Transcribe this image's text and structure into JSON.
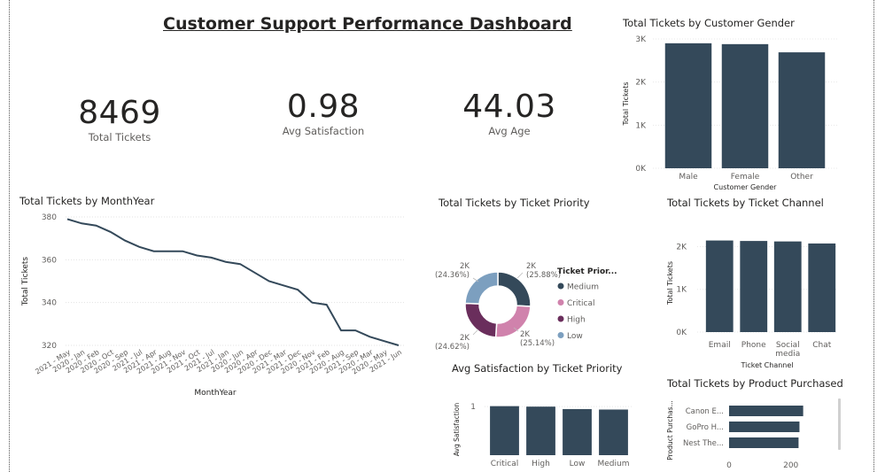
{
  "dashboard_title": "Customer Support Performance Dashboard",
  "kpis": {
    "total_tickets": {
      "value": "8469",
      "label": "Total Tickets"
    },
    "avg_satisfaction": {
      "value": "0.98",
      "label": "Avg Satisfaction"
    },
    "avg_age": {
      "value": "44.03",
      "label": "Avg Age"
    }
  },
  "colors": {
    "bar": "#34495a",
    "line": "#34495a",
    "medium": "#34495a",
    "critical": "#d082ac",
    "high": "#6a2e5c",
    "low": "#7c9fbf"
  },
  "chart_data": [
    {
      "id": "gender",
      "type": "bar",
      "title": "Total Tickets by Customer Gender",
      "xlabel": "Customer Gender",
      "ylabel": "Total Tickets",
      "categories": [
        "Male",
        "Female",
        "Other"
      ],
      "values": [
        2900,
        2880,
        2690
      ],
      "ylim": [
        0,
        3000
      ],
      "yticks": [
        0,
        1000,
        2000,
        3000
      ],
      "yticklabels": [
        "0K",
        "1K",
        "2K",
        "3K"
      ]
    },
    {
      "id": "monthyear",
      "type": "line",
      "title": "Total Tickets by MonthYear",
      "xlabel": "MonthYear",
      "ylabel": "Total Tickets",
      "categories": [
        "2021 - May",
        "2020 - Jan",
        "2020 - Feb",
        "2020 - Oct",
        "2020 - Sep",
        "2021 - Jul",
        "2021 - Apr",
        "2021 - Aug",
        "2021 - Nov",
        "2021 - Oct",
        "2021 - Jul",
        "2021 - Jan",
        "2020 - Jun",
        "2020 - Apr",
        "2020 - Dec",
        "2021 - Mar",
        "2021 - Dec",
        "2020 - Nov",
        "2021 - Feb",
        "2020 - Aug",
        "2021 - Sep",
        "2020 - Mar",
        "2020 - May",
        "2021 - Jun"
      ],
      "values": [
        379,
        377,
        376,
        373,
        369,
        366,
        364,
        364,
        364,
        362,
        361,
        359,
        358,
        354,
        350,
        348,
        346,
        340,
        339,
        327,
        327,
        324,
        322,
        320
      ],
      "ylim": [
        320,
        380
      ],
      "yticks": [
        320,
        340,
        360,
        380
      ]
    },
    {
      "id": "priority",
      "type": "pie",
      "title": "Total Tickets by Ticket Priority",
      "legend_title": "Ticket Prior...",
      "categories": [
        "Medium",
        "Critical",
        "High",
        "Low"
      ],
      "values": [
        2192,
        2129,
        2085,
        2063
      ],
      "percent_labels": [
        "(25.88%)",
        "(25.14%)",
        "(24.62%)",
        "(24.36%)"
      ],
      "value_labels": [
        "2K",
        "2K",
        "2K",
        "2K"
      ]
    },
    {
      "id": "channel",
      "type": "bar",
      "title": "Total Tickets by Ticket Channel",
      "xlabel": "Ticket Channel",
      "ylabel": "Total Tickets",
      "categories": [
        "Email",
        "Phone",
        "Social media",
        "Chat"
      ],
      "values": [
        2143,
        2132,
        2121,
        2073
      ],
      "ylim": [
        0,
        2300
      ],
      "yticks": [
        0,
        1000,
        2000
      ],
      "yticklabels": [
        "0K",
        "1K",
        "2K"
      ]
    },
    {
      "id": "satisfaction",
      "type": "bar",
      "title": "Avg Satisfaction by Ticket Priority",
      "xlabel": "",
      "ylabel": "Avg Satisfaction",
      "categories": [
        "Critical",
        "High",
        "Low",
        "Medium"
      ],
      "values": [
        1.01,
        1.0,
        0.95,
        0.94
      ],
      "ylim": [
        0,
        1.35
      ],
      "yticks": [
        1
      ],
      "yticklabels": [
        "1"
      ]
    },
    {
      "id": "product",
      "type": "bar",
      "orientation": "horizontal",
      "title": "Total Tickets by Product Purchased",
      "ylabel": "Product Purchas...",
      "categories": [
        "Canon E...",
        "GoPro H...",
        "Nest The..."
      ],
      "values": [
        240,
        228,
        225
      ],
      "xlim": [
        0,
        330
      ],
      "xticks": [
        0,
        200
      ],
      "xticklabels": [
        "0",
        "200"
      ]
    }
  ]
}
